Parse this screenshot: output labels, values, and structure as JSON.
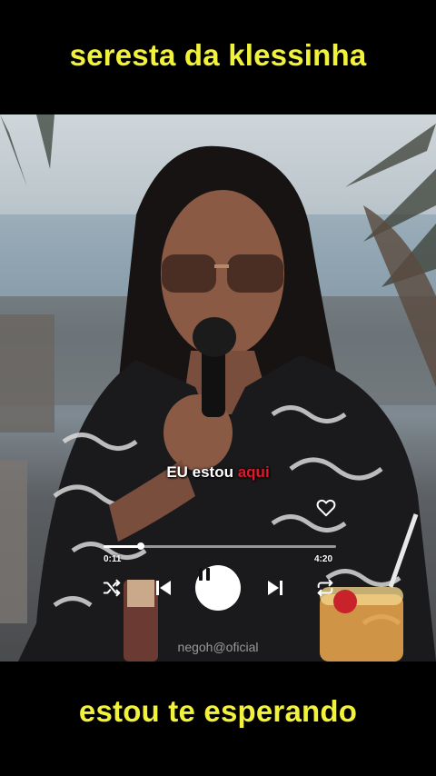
{
  "captions": {
    "top": "seresta da klessinha",
    "bottom": "estou te esperando"
  },
  "player": {
    "lyric_plain": "EU estou ",
    "lyric_highlight": "aqui",
    "time_current": "0:11",
    "time_total": "4:20",
    "progress_fraction": 0.16,
    "liked": false,
    "watermark": "negoh@oficial"
  },
  "icons": {
    "heart": "heart-outline-icon",
    "shuffle": "shuffle-icon",
    "previous": "skip-previous-icon",
    "pause": "pause-icon",
    "next": "skip-next-icon",
    "repeat": "repeat-icon"
  },
  "colors": {
    "caption_text": "#f2f23a",
    "lyric_highlight": "#e0192a",
    "background": "#000000"
  }
}
